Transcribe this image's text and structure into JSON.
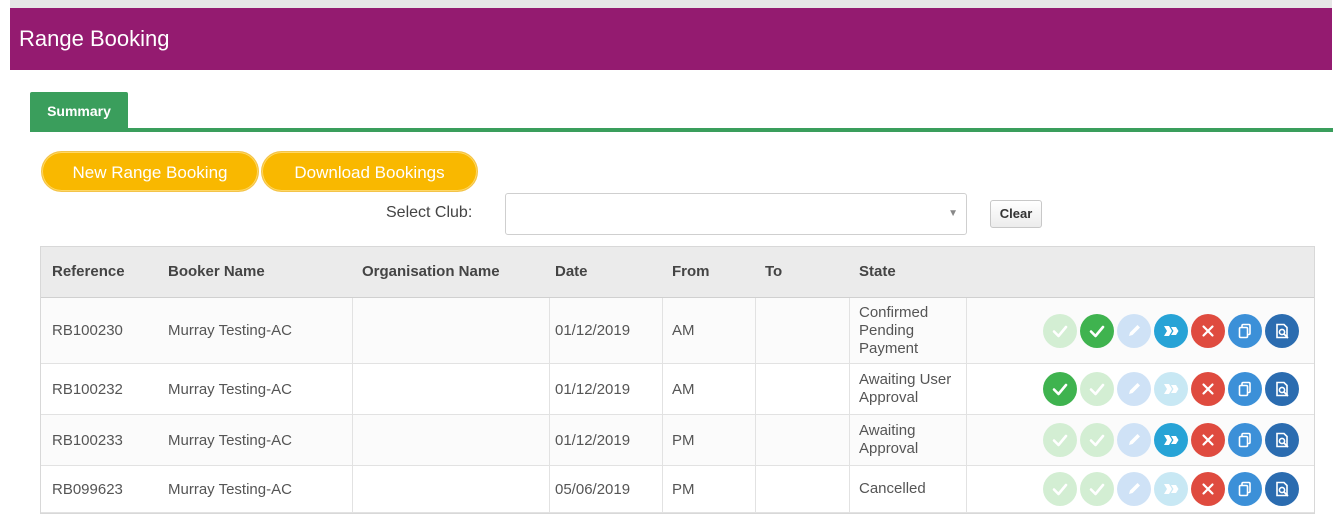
{
  "header": {
    "title": "Range Booking"
  },
  "tabs": [
    {
      "label": "Summary"
    }
  ],
  "toolbar": {
    "new_label": "New Range Booking",
    "download_label": "Download Bookings"
  },
  "filter": {
    "label": "Select Club:",
    "value": "",
    "clear_label": "Clear"
  },
  "table": {
    "columns": [
      "Reference",
      "Booker Name",
      "Organisation Name",
      "Date",
      "From",
      "To",
      "State"
    ],
    "rows": [
      {
        "reference": "RB100230",
        "booker": "Murray Testing-AC",
        "organisation": "",
        "date": "01/12/2019",
        "from": "AM",
        "to": "",
        "state": "Confirmed\nPending\nPayment",
        "actions": [
          "approve-disabled",
          "confirm",
          "edit-disabled",
          "transfer",
          "cancel",
          "copy",
          "view"
        ]
      },
      {
        "reference": "RB100232",
        "booker": "Murray Testing-AC",
        "organisation": "",
        "date": "01/12/2019",
        "from": "AM",
        "to": "",
        "state": "Awaiting User\nApproval",
        "actions": [
          "approve",
          "confirm-disabled",
          "edit-disabled",
          "transfer-disabled",
          "cancel",
          "copy",
          "view"
        ]
      },
      {
        "reference": "RB100233",
        "booker": "Murray Testing-AC",
        "organisation": "",
        "date": "01/12/2019",
        "from": "PM",
        "to": "",
        "state": "Awaiting\nApproval",
        "actions": [
          "approve-disabled",
          "confirm-disabled",
          "edit-disabled",
          "transfer",
          "cancel",
          "copy",
          "view"
        ]
      },
      {
        "reference": "RB099623",
        "booker": "Murray Testing-AC",
        "organisation": "",
        "date": "05/06/2019",
        "from": "PM",
        "to": "",
        "state": "Cancelled",
        "actions": [
          "approve-disabled",
          "confirm-disabled",
          "edit-disabled",
          "transfer-disabled",
          "cancel",
          "copy",
          "view"
        ]
      }
    ]
  },
  "colors": {
    "header": "#941b70",
    "tab": "#3a9e5c",
    "pill": "#f9b800",
    "green": "#3fb34f",
    "teal": "#27a3d6",
    "red": "#df4b3f",
    "blue": "#3c90d8"
  }
}
